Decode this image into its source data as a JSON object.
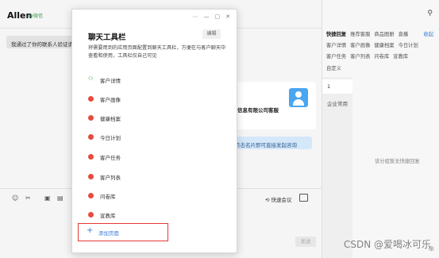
{
  "chat": {
    "name": "Allen",
    "badge": "@微信",
    "verify_message": "我通过了你的联系人验证请",
    "card_title": "信息有限公司客服",
    "card_tip": "点击名片即可直接发起咨询",
    "toolbar": {
      "emoji_icon": "☺",
      "scissors_icon": "✂",
      "image_icon": "▣",
      "file_icon": "▤",
      "quick_meeting_label": "快速会议",
      "send_label": "发送"
    }
  },
  "side": {
    "user_icon": "⚲",
    "tabs_row1": [
      "快捷回复",
      "推荐客服",
      "商品图册",
      "直播"
    ],
    "tabs_row2": [
      "客户详情",
      "客户画像",
      "健康档案",
      "今日计划"
    ],
    "tabs_row3": [
      "客户任务",
      "客户列表",
      "问卷库",
      "宣教库"
    ],
    "tabs_row4": [
      "自定义"
    ],
    "collapse_label": "收起",
    "list": [
      "1",
      "企业常用"
    ],
    "empty_text": "该分组暂无快捷回复",
    "footer_icon": "⊕"
  },
  "modal": {
    "title": "聊天工具栏",
    "edit_label": "编辑",
    "description": "将需要用到的应用页面配置到聊天工具栏，方便在与客户聊天中查看和使用，工具栏仅自己可见",
    "controls": [
      "⋯",
      "—",
      "▢",
      "✕"
    ],
    "items": [
      {
        "label": "客户详情",
        "icon": "person-icon"
      },
      {
        "label": "客户画像",
        "icon": "app-icon"
      },
      {
        "label": "健康档案",
        "icon": "app-icon"
      },
      {
        "label": "今日计划",
        "icon": "app-icon"
      },
      {
        "label": "客户任务",
        "icon": "app-icon"
      },
      {
        "label": "客户列表",
        "icon": "app-icon"
      },
      {
        "label": "问卷库",
        "icon": "app-icon"
      },
      {
        "label": "宣教库",
        "icon": "app-icon"
      }
    ],
    "add_page_label": "添加页面",
    "add_page_plus": "+"
  },
  "watermark": "CSDN @爱喝冰可乐",
  "colors": {
    "accent": "#3a7bd5",
    "highlight_border": "#e53935",
    "app_icon": "#e64b3c",
    "person_icon": "#2eaa55"
  }
}
